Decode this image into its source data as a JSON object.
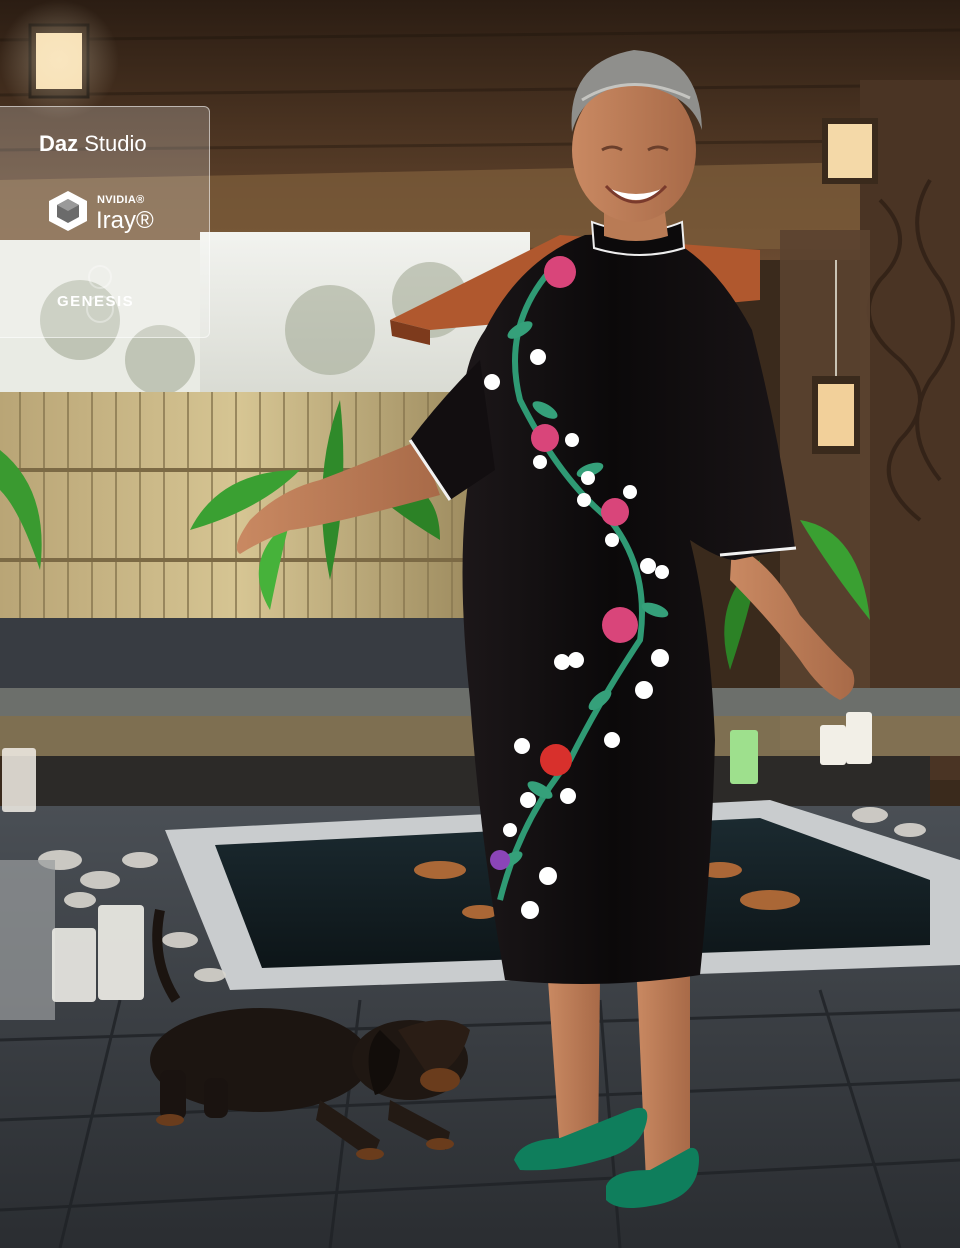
{
  "badge": {
    "brand_bold": "Daz",
    "brand_rest": " Studio",
    "iray_small": "NVIDIA®",
    "iray_big": "Iray®",
    "genesis": "GENESIS"
  },
  "icons": {
    "iray": "iray-cube-icon",
    "genesis": "genesis-8-mark-icon"
  },
  "colors": {
    "dress": "#0e0b0c",
    "shoes": "#0f7e5c",
    "badge_text": "#ffffff"
  }
}
